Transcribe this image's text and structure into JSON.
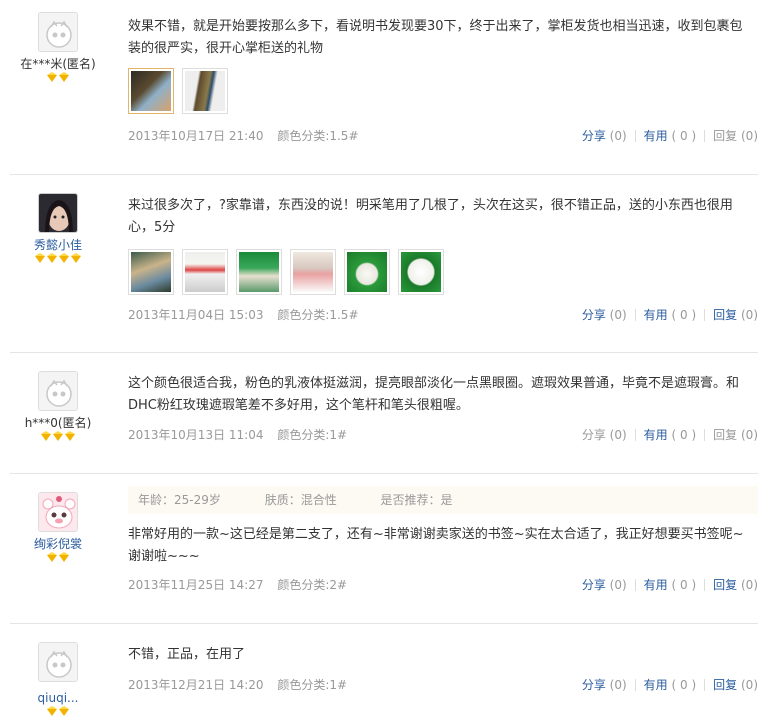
{
  "reviews": [
    {
      "user": "在***米(匿名)",
      "user_style": "anon",
      "avatar": "default",
      "gems": 2,
      "text": "效果不错，就是开始要按那么多下，看说明书发现要30下，终于出来了，掌柜发货也相当迅速，收到包裹包装的很严实，很开心掌柜送的礼物",
      "thumbs": [
        "pkg-photo-1",
        "pkg-photo-2"
      ],
      "date": "2013年10月17日 21:40",
      "spec": "颜色分类:1.5#",
      "share": "分享",
      "share_count": "(0)",
      "useful": "有用",
      "useful_count": "( 0 )",
      "reply": "回复",
      "reply_count": "(0)"
    },
    {
      "user": "秀懿小佳",
      "user_style": "link",
      "avatar": "photo",
      "gems": 4,
      "text": "来过很多次了，?家靠谱，东西没的说！明采笔用了几根了，头次在这买，很不错正品，送的小东西也很用心，5分",
      "thumbs": [
        "product-photo-1",
        "product-photo-2",
        "product-photo-3",
        "product-photo-4",
        "product-photo-5"
      ],
      "date": "2013年11月04日 15:03",
      "spec": "颜色分类:1.5#",
      "share": "分享",
      "share_count": "(0)",
      "useful": "有用",
      "useful_count": "( 0 )",
      "reply": "回复",
      "reply_count": "(0)"
    },
    {
      "user": "h***0(匿名)",
      "user_style": "anon",
      "avatar": "default",
      "gems": 3,
      "text": "这个颜色很适合我，粉色的乳液体挺滋润，提亮眼部淡化一点黑眼圈。遮瑕效果普通，毕竟不是遮瑕膏。和DHC粉红玫瑰遮瑕笔差不多好用，这个笔杆和笔头很粗喔。",
      "thumbs": [],
      "date": "2013年10月13日 11:04",
      "spec": "颜色分类:1#",
      "share": "分享",
      "share_count": "(0)",
      "useful": "有用",
      "useful_count": "( 0 )",
      "reply": "回复",
      "reply_count": "(0)"
    },
    {
      "user": "绚彩倪裳",
      "user_style": "link",
      "avatar": "cartoon",
      "gems": 2,
      "profile": {
        "age": "年龄：25-29岁",
        "skin": "肤质：混合性",
        "recommend": "是否推荐：是"
      },
      "text": "非常好用的一款~这已经是第二支了，还有~非常谢谢卖家送的书签~实在太合适了，我正好想要买书签呢~谢谢啦~~~",
      "thumbs": [],
      "date": "2013年11月25日 14:27",
      "spec": "颜色分类:2#",
      "share": "分享",
      "share_count": "(0)",
      "useful": "有用",
      "useful_count": "( 0 )",
      "reply": "回复",
      "reply_count": "(0)"
    },
    {
      "user": "qiuqi...",
      "user_style": "link",
      "avatar": "default",
      "gems": 2,
      "text": "不错，正品，在用了",
      "thumbs": [],
      "date": "2013年12月21日 14:20",
      "spec": "颜色分类:1#",
      "share": "分享",
      "share_count": "(0)",
      "useful": "有用",
      "useful_count": "( 0 )",
      "reply": "回复",
      "reply_count": "(0)"
    }
  ]
}
